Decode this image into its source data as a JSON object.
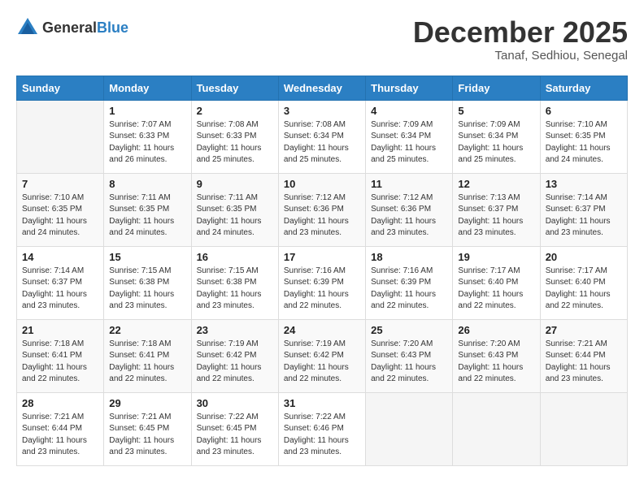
{
  "header": {
    "logo_general": "General",
    "logo_blue": "Blue",
    "month_year": "December 2025",
    "location": "Tanaf, Sedhiou, Senegal"
  },
  "weekdays": [
    "Sunday",
    "Monday",
    "Tuesday",
    "Wednesday",
    "Thursday",
    "Friday",
    "Saturday"
  ],
  "weeks": [
    [
      {
        "day": "",
        "sunrise": "",
        "sunset": "",
        "daylight": ""
      },
      {
        "day": "1",
        "sunrise": "Sunrise: 7:07 AM",
        "sunset": "Sunset: 6:33 PM",
        "daylight": "Daylight: 11 hours and 26 minutes."
      },
      {
        "day": "2",
        "sunrise": "Sunrise: 7:08 AM",
        "sunset": "Sunset: 6:33 PM",
        "daylight": "Daylight: 11 hours and 25 minutes."
      },
      {
        "day": "3",
        "sunrise": "Sunrise: 7:08 AM",
        "sunset": "Sunset: 6:34 PM",
        "daylight": "Daylight: 11 hours and 25 minutes."
      },
      {
        "day": "4",
        "sunrise": "Sunrise: 7:09 AM",
        "sunset": "Sunset: 6:34 PM",
        "daylight": "Daylight: 11 hours and 25 minutes."
      },
      {
        "day": "5",
        "sunrise": "Sunrise: 7:09 AM",
        "sunset": "Sunset: 6:34 PM",
        "daylight": "Daylight: 11 hours and 25 minutes."
      },
      {
        "day": "6",
        "sunrise": "Sunrise: 7:10 AM",
        "sunset": "Sunset: 6:35 PM",
        "daylight": "Daylight: 11 hours and 24 minutes."
      }
    ],
    [
      {
        "day": "7",
        "sunrise": "Sunrise: 7:10 AM",
        "sunset": "Sunset: 6:35 PM",
        "daylight": "Daylight: 11 hours and 24 minutes."
      },
      {
        "day": "8",
        "sunrise": "Sunrise: 7:11 AM",
        "sunset": "Sunset: 6:35 PM",
        "daylight": "Daylight: 11 hours and 24 minutes."
      },
      {
        "day": "9",
        "sunrise": "Sunrise: 7:11 AM",
        "sunset": "Sunset: 6:35 PM",
        "daylight": "Daylight: 11 hours and 24 minutes."
      },
      {
        "day": "10",
        "sunrise": "Sunrise: 7:12 AM",
        "sunset": "Sunset: 6:36 PM",
        "daylight": "Daylight: 11 hours and 23 minutes."
      },
      {
        "day": "11",
        "sunrise": "Sunrise: 7:12 AM",
        "sunset": "Sunset: 6:36 PM",
        "daylight": "Daylight: 11 hours and 23 minutes."
      },
      {
        "day": "12",
        "sunrise": "Sunrise: 7:13 AM",
        "sunset": "Sunset: 6:37 PM",
        "daylight": "Daylight: 11 hours and 23 minutes."
      },
      {
        "day": "13",
        "sunrise": "Sunrise: 7:14 AM",
        "sunset": "Sunset: 6:37 PM",
        "daylight": "Daylight: 11 hours and 23 minutes."
      }
    ],
    [
      {
        "day": "14",
        "sunrise": "Sunrise: 7:14 AM",
        "sunset": "Sunset: 6:37 PM",
        "daylight": "Daylight: 11 hours and 23 minutes."
      },
      {
        "day": "15",
        "sunrise": "Sunrise: 7:15 AM",
        "sunset": "Sunset: 6:38 PM",
        "daylight": "Daylight: 11 hours and 23 minutes."
      },
      {
        "day": "16",
        "sunrise": "Sunrise: 7:15 AM",
        "sunset": "Sunset: 6:38 PM",
        "daylight": "Daylight: 11 hours and 23 minutes."
      },
      {
        "day": "17",
        "sunrise": "Sunrise: 7:16 AM",
        "sunset": "Sunset: 6:39 PM",
        "daylight": "Daylight: 11 hours and 22 minutes."
      },
      {
        "day": "18",
        "sunrise": "Sunrise: 7:16 AM",
        "sunset": "Sunset: 6:39 PM",
        "daylight": "Daylight: 11 hours and 22 minutes."
      },
      {
        "day": "19",
        "sunrise": "Sunrise: 7:17 AM",
        "sunset": "Sunset: 6:40 PM",
        "daylight": "Daylight: 11 hours and 22 minutes."
      },
      {
        "day": "20",
        "sunrise": "Sunrise: 7:17 AM",
        "sunset": "Sunset: 6:40 PM",
        "daylight": "Daylight: 11 hours and 22 minutes."
      }
    ],
    [
      {
        "day": "21",
        "sunrise": "Sunrise: 7:18 AM",
        "sunset": "Sunset: 6:41 PM",
        "daylight": "Daylight: 11 hours and 22 minutes."
      },
      {
        "day": "22",
        "sunrise": "Sunrise: 7:18 AM",
        "sunset": "Sunset: 6:41 PM",
        "daylight": "Daylight: 11 hours and 22 minutes."
      },
      {
        "day": "23",
        "sunrise": "Sunrise: 7:19 AM",
        "sunset": "Sunset: 6:42 PM",
        "daylight": "Daylight: 11 hours and 22 minutes."
      },
      {
        "day": "24",
        "sunrise": "Sunrise: 7:19 AM",
        "sunset": "Sunset: 6:42 PM",
        "daylight": "Daylight: 11 hours and 22 minutes."
      },
      {
        "day": "25",
        "sunrise": "Sunrise: 7:20 AM",
        "sunset": "Sunset: 6:43 PM",
        "daylight": "Daylight: 11 hours and 22 minutes."
      },
      {
        "day": "26",
        "sunrise": "Sunrise: 7:20 AM",
        "sunset": "Sunset: 6:43 PM",
        "daylight": "Daylight: 11 hours and 22 minutes."
      },
      {
        "day": "27",
        "sunrise": "Sunrise: 7:21 AM",
        "sunset": "Sunset: 6:44 PM",
        "daylight": "Daylight: 11 hours and 23 minutes."
      }
    ],
    [
      {
        "day": "28",
        "sunrise": "Sunrise: 7:21 AM",
        "sunset": "Sunset: 6:44 PM",
        "daylight": "Daylight: 11 hours and 23 minutes."
      },
      {
        "day": "29",
        "sunrise": "Sunrise: 7:21 AM",
        "sunset": "Sunset: 6:45 PM",
        "daylight": "Daylight: 11 hours and 23 minutes."
      },
      {
        "day": "30",
        "sunrise": "Sunrise: 7:22 AM",
        "sunset": "Sunset: 6:45 PM",
        "daylight": "Daylight: 11 hours and 23 minutes."
      },
      {
        "day": "31",
        "sunrise": "Sunrise: 7:22 AM",
        "sunset": "Sunset: 6:46 PM",
        "daylight": "Daylight: 11 hours and 23 minutes."
      },
      {
        "day": "",
        "sunrise": "",
        "sunset": "",
        "daylight": ""
      },
      {
        "day": "",
        "sunrise": "",
        "sunset": "",
        "daylight": ""
      },
      {
        "day": "",
        "sunrise": "",
        "sunset": "",
        "daylight": ""
      }
    ]
  ]
}
